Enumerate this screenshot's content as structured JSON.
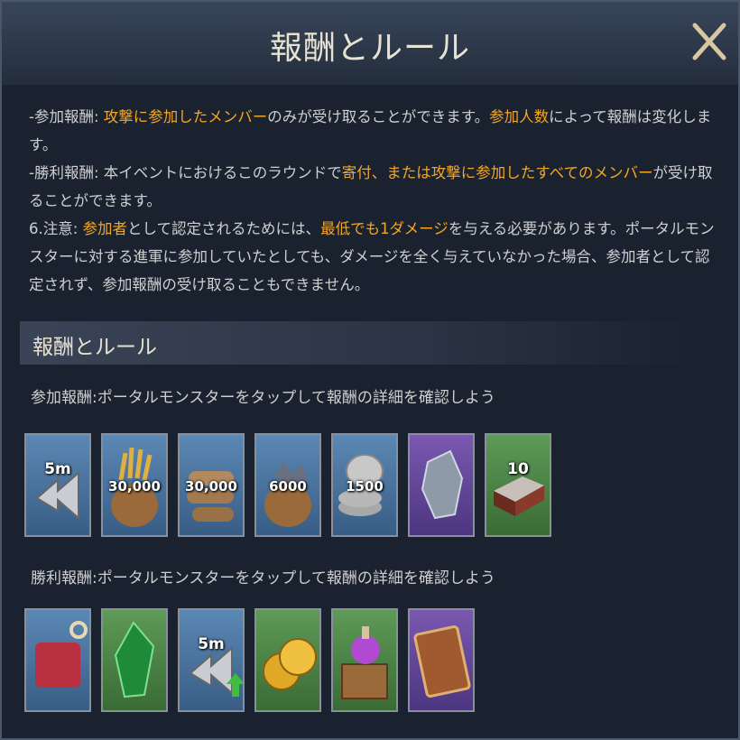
{
  "window": {
    "title": "報酬とルール"
  },
  "rules": {
    "line1": [
      {
        "t": "-参加報酬: ",
        "h": false
      },
      {
        "t": "攻撃に参加したメンバー",
        "h": true
      },
      {
        "t": "のみが受け取ることができます。",
        "h": false
      },
      {
        "t": "参加人数",
        "h": true
      },
      {
        "t": "によって報酬は変化します。",
        "h": false
      }
    ],
    "line2": [
      {
        "t": "-勝利報酬: 本イベントにおけるこのラウンドで",
        "h": false
      },
      {
        "t": "寄付、または攻撃に参加したすべてのメンバー",
        "h": true
      },
      {
        "t": "が受け取ることができます。",
        "h": false
      }
    ],
    "line3": [
      {
        "t": "6.注意: ",
        "h": false
      },
      {
        "t": "参加者",
        "h": true
      },
      {
        "t": "として認定されるためには、",
        "h": false
      },
      {
        "t": "最低でも1ダメージ",
        "h": true
      },
      {
        "t": "を与える必要があります。ポータルモンスターに対する進軍に参加していたとしても、ダメージを全く与えていなかった場合、参加者として認定されず、参加報酬の受け取ることもできません。",
        "h": false
      }
    ]
  },
  "section": {
    "title": "報酬とルール"
  },
  "participation": {
    "desc": "参加報酬:ポータルモンスターをタップして報酬の詳細を確認しよう",
    "items": [
      {
        "icon": "speedup-5m-icon",
        "label": "5m",
        "color": "blue"
      },
      {
        "icon": "wheat-sack-icon",
        "label": "30,000",
        "color": "blue"
      },
      {
        "icon": "wood-logs-icon",
        "label": "30,000",
        "color": "blue"
      },
      {
        "icon": "ore-sack-icon",
        "label": "6000",
        "color": "blue"
      },
      {
        "icon": "silver-coins-icon",
        "label": "1500",
        "color": "blue"
      },
      {
        "icon": "crystal-ore-icon",
        "label": "",
        "color": "purple"
      },
      {
        "icon": "iron-ingot-icon",
        "label": "10",
        "color": "green"
      }
    ]
  },
  "victory": {
    "desc": "勝利報酬:ポータルモンスターをタップして報酬の詳細を確認しよう",
    "items": [
      {
        "icon": "meat-ribs-icon",
        "label": "",
        "color": "blue"
      },
      {
        "icon": "green-gem-icon",
        "label": "",
        "color": "green"
      },
      {
        "icon": "march-speedup-5m-icon",
        "label": "5m",
        "color": "blue"
      },
      {
        "icon": "gold-coins-icon",
        "label": "",
        "color": "green"
      },
      {
        "icon": "potion-chest-icon",
        "label": "",
        "color": "green"
      },
      {
        "icon": "rune-card-icon",
        "label": "",
        "color": "purple"
      }
    ]
  }
}
